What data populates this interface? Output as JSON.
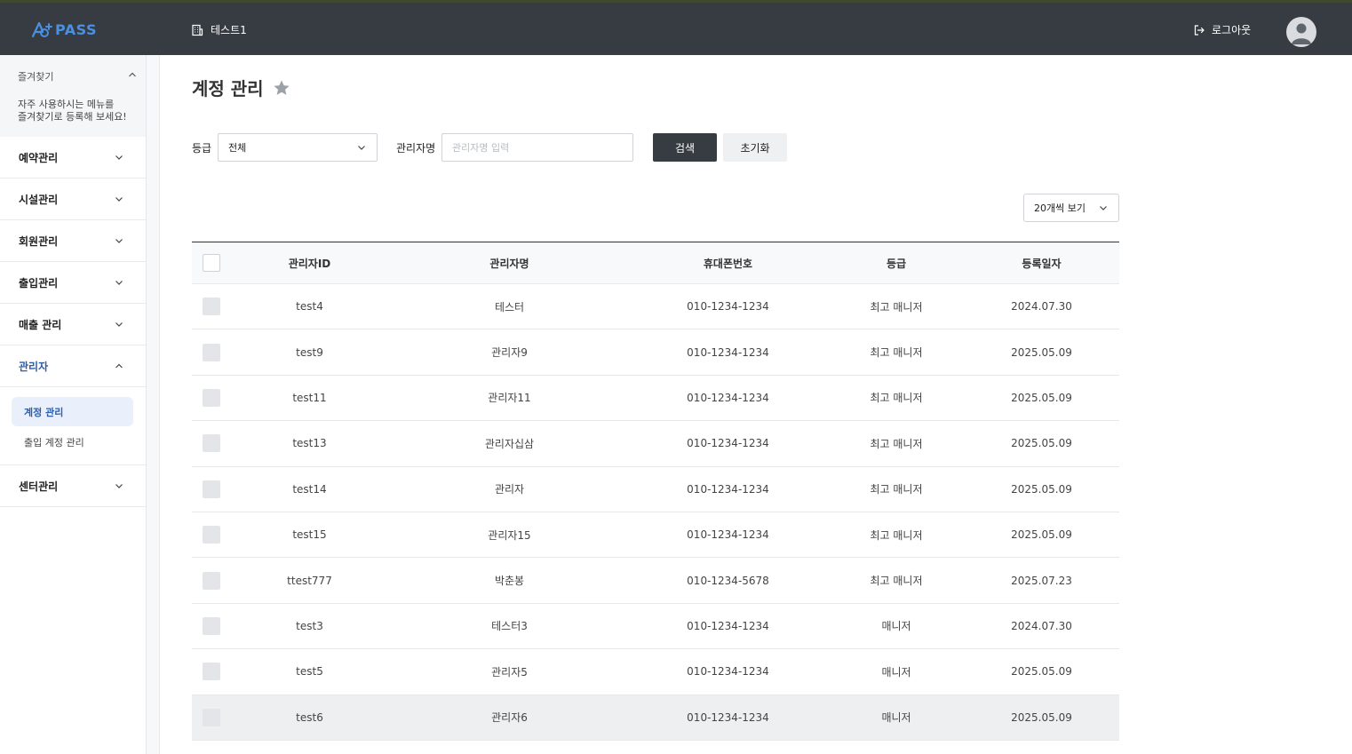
{
  "header": {
    "logo_text": "PASS",
    "center_name": "테스트1",
    "logout_label": "로그아웃"
  },
  "sidebar": {
    "favorites": {
      "title": "즐겨찾기",
      "description": "자주 사용하시는 메뉴를\n즐겨찾기로 등록해 보세요!"
    },
    "items": [
      {
        "label": "예약관리"
      },
      {
        "label": "시설관리"
      },
      {
        "label": "회원관리"
      },
      {
        "label": "출입관리"
      },
      {
        "label": "매출 관리"
      },
      {
        "label": "관리자"
      },
      {
        "label": "센터관리"
      }
    ],
    "submenu": [
      {
        "label": "계정 관리"
      },
      {
        "label": "출입 계정 관리"
      }
    ]
  },
  "page": {
    "title": "계정 관리"
  },
  "filters": {
    "grade_label": "등급",
    "grade_value": "전체",
    "name_label": "관리자명",
    "name_placeholder": "관리자명 입력",
    "search_label": "검색",
    "reset_label": "초기화",
    "page_size_label": "20개씩 보기"
  },
  "table": {
    "columns": [
      "관리자ID",
      "관리자명",
      "휴대폰번호",
      "등급",
      "등록일자"
    ],
    "rows": [
      [
        "test4",
        "테스터",
        "010-1234-1234",
        "최고 매니저",
        "2024.07.30"
      ],
      [
        "test9",
        "관리자9",
        "010-1234-1234",
        "최고 매니저",
        "2025.05.09"
      ],
      [
        "test11",
        "관리자11",
        "010-1234-1234",
        "최고 매니저",
        "2025.05.09"
      ],
      [
        "test13",
        "관리자십삼",
        "010-1234-1234",
        "최고 매니저",
        "2025.05.09"
      ],
      [
        "test14",
        "관리자",
        "010-1234-1234",
        "최고 매니저",
        "2025.05.09"
      ],
      [
        "test15",
        "관리자15",
        "010-1234-1234",
        "최고 매니저",
        "2025.05.09"
      ],
      [
        "ttest777",
        "박춘봉",
        "010-1234-5678",
        "최고 매니저",
        "2025.07.23"
      ],
      [
        "test3",
        "테스터3",
        "010-1234-1234",
        "매니저",
        "2024.07.30"
      ],
      [
        "test5",
        "관리자5",
        "010-1234-1234",
        "매니저",
        "2025.05.09"
      ],
      [
        "test6",
        "관리자6",
        "010-1234-1234",
        "매니저",
        "2025.05.09"
      ]
    ]
  },
  "colors": {
    "topbar": "#373c42",
    "brand": "#4a8fe0",
    "active_menu": "#2f5ea8",
    "active_sub_bg": "#eaf0fb"
  }
}
